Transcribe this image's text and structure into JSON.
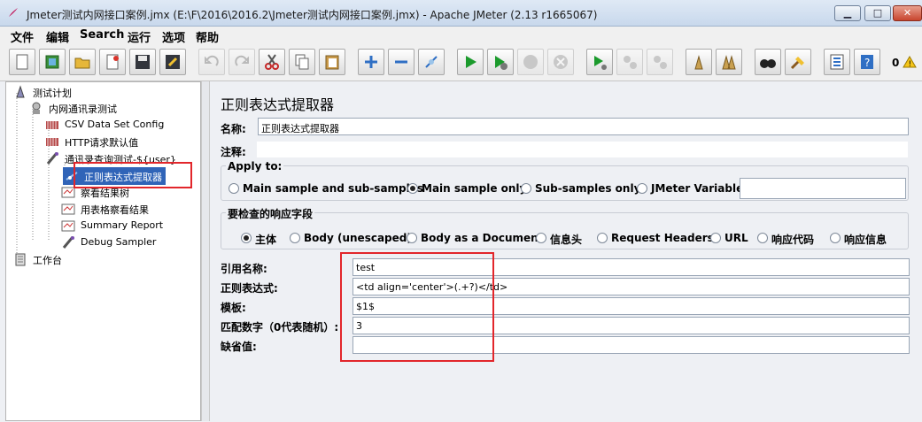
{
  "window": {
    "title": "Jmeter测试内网接口案例.jmx (E:\\F\\2016\\2016.2\\Jmeter测试内网接口案例.jmx) - Apache JMeter (2.13 r1665067)",
    "minimize": "▁",
    "maximize": "□",
    "close": "✕"
  },
  "menu": [
    "文件",
    "编辑",
    "Search",
    "运行",
    "选项",
    "帮助"
  ],
  "toolbar": {
    "icons": [
      "new-icon",
      "templates-icon",
      "open-icon",
      "close-file-icon",
      "save-icon",
      "save-as-icon",
      "undo-icon",
      "redo-icon",
      "cut-icon",
      "copy-icon",
      "paste-icon",
      "expand-icon",
      "collapse-icon",
      "toggle-icon",
      "start-icon",
      "start-no-pause-icon",
      "stop-icon",
      "shutdown-icon",
      "remote-start-icon",
      "remote-stop-icon",
      "remote-shutdown-icon",
      "clear-icon",
      "clear-all-icon",
      "search-icon",
      "reset-search-icon",
      "function-helper-icon",
      "help-icon"
    ],
    "error_count": "0",
    "warning_icon": "warning-icon"
  },
  "tree": {
    "nodes": [
      {
        "label": "测试计划",
        "icon": "test-plan-icon"
      },
      {
        "label": "内网通讯录测试",
        "icon": "thread-group-icon"
      },
      {
        "label": "CSV Data Set Config",
        "icon": "config-icon"
      },
      {
        "label": "HTTP请求默认值",
        "icon": "config-icon"
      },
      {
        "label": "通讯录查询测试-${user}",
        "icon": "sampler-icon"
      },
      {
        "label": "正则表达式提取器",
        "icon": "extractor-icon"
      },
      {
        "label": "察看结果树",
        "icon": "listener-icon"
      },
      {
        "label": "用表格察看结果",
        "icon": "listener-icon"
      },
      {
        "label": "Summary Report",
        "icon": "listener-icon"
      },
      {
        "label": "Debug Sampler",
        "icon": "sampler-icon"
      },
      {
        "label": "工作台",
        "icon": "workbench-icon"
      }
    ]
  },
  "panel": {
    "heading": "正则表达式提取器",
    "name_label": "名称:",
    "name_value": "正则表达式提取器",
    "comment_label": "注释:",
    "comment_value": "",
    "apply_to": {
      "legend": "Apply to:",
      "options": [
        "Main sample and sub-samples",
        "Main sample only",
        "Sub-samples only",
        "JMeter Variable"
      ],
      "selected": "Main sample only",
      "variable_value": ""
    },
    "response_field": {
      "legend": "要检查的响应字段",
      "options": [
        "主体",
        "Body (unescaped)",
        "Body as a Document",
        "信息头",
        "Request Headers",
        "URL",
        "响应代码",
        "响应信息"
      ],
      "selected": "主体"
    },
    "ref_name_label": "引用名称:",
    "ref_name_value": "test",
    "regex_label": "正则表达式:",
    "regex_value": "<td align='center'>(.+?)</td>",
    "template_label": "模板:",
    "template_value": "$1$",
    "match_no_label": "匹配数字（0代表随机）:",
    "match_no_value": "3",
    "default_label": "缺省值:",
    "default_value": ""
  },
  "colors": {
    "highlight_box": "#e2262b",
    "selected_node": "#3064b8"
  }
}
